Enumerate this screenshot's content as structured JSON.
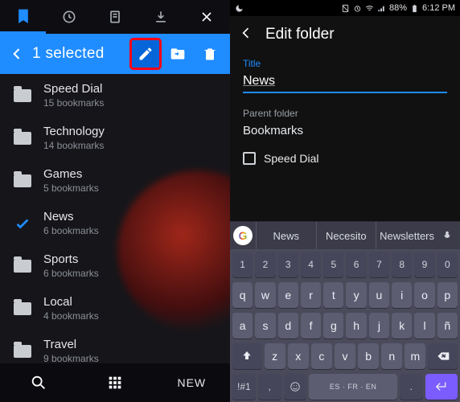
{
  "left": {
    "selection_label": "1 selected",
    "folders": [
      {
        "name": "Speed Dial",
        "sub": "15 bookmarks",
        "selected": false
      },
      {
        "name": "Technology",
        "sub": "14 bookmarks",
        "selected": false
      },
      {
        "name": "Games",
        "sub": "5 bookmarks",
        "selected": false
      },
      {
        "name": "News",
        "sub": "6 bookmarks",
        "selected": true
      },
      {
        "name": "Sports",
        "sub": "6 bookmarks",
        "selected": false
      },
      {
        "name": "Local",
        "sub": "4 bookmarks",
        "selected": false
      },
      {
        "name": "Travel",
        "sub": "9 bookmarks",
        "selected": false
      }
    ],
    "new_label": "NEW"
  },
  "right": {
    "status": {
      "battery": "88%",
      "time": "6:12 PM"
    },
    "header": "Edit folder",
    "title_label": "Title",
    "title_value": "News",
    "parent_label": "Parent folder",
    "parent_value": "Bookmarks",
    "speed_dial_label": "Speed Dial",
    "suggestions": [
      "News",
      "Necesito",
      "Newsletters"
    ],
    "keys_num": [
      "1",
      "2",
      "3",
      "4",
      "5",
      "6",
      "7",
      "8",
      "9",
      "0"
    ],
    "keys_r1": [
      "q",
      "w",
      "e",
      "r",
      "t",
      "y",
      "u",
      "i",
      "o",
      "p"
    ],
    "keys_r2": [
      "a",
      "s",
      "d",
      "f",
      "g",
      "h",
      "j",
      "k",
      "l",
      "ñ"
    ],
    "keys_r3": [
      "z",
      "x",
      "c",
      "v",
      "b",
      "n",
      "m"
    ],
    "sym_key": "!#1",
    "lang_label": "ES · FR · EN"
  }
}
